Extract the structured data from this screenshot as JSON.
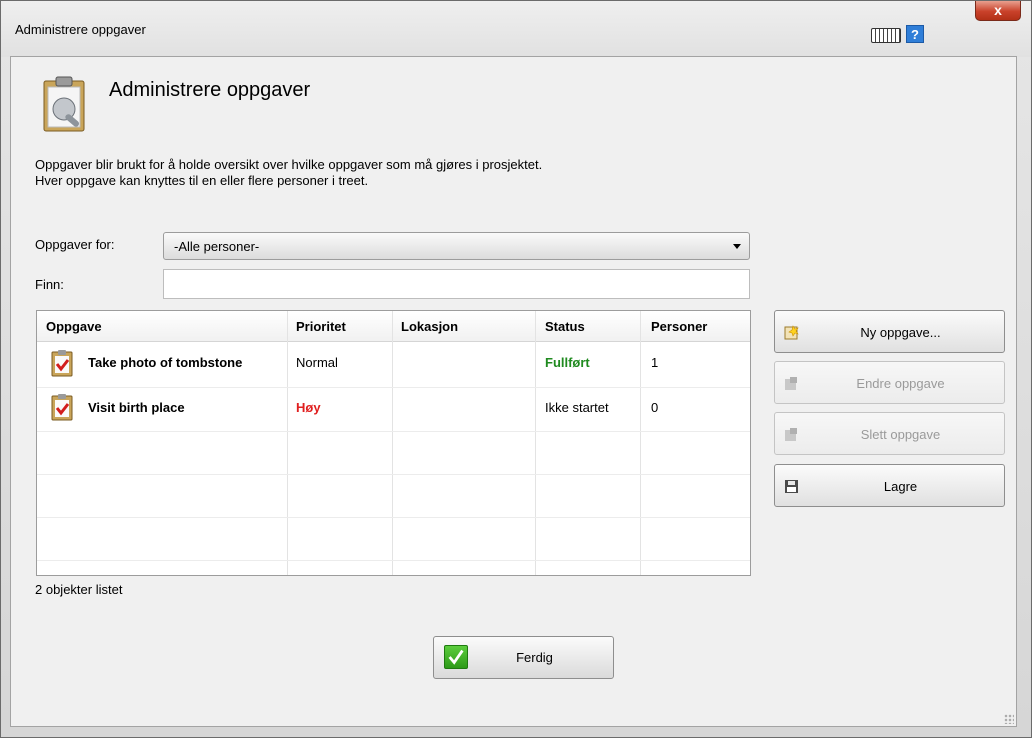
{
  "window": {
    "title": "Administrere oppgaver",
    "close_label": "x",
    "help_label": "?"
  },
  "header": {
    "title": "Administrere oppgaver",
    "description_line1": "Oppgaver blir brukt for å holde oversikt over hvilke oppgaver som må gjøres i prosjektet.",
    "description_line2": "Hver oppgave kan knyttes til en eller flere personer i treet."
  },
  "filter": {
    "label": "Oppgaver for:",
    "selected": "-Alle personer-"
  },
  "search": {
    "label": "Finn:",
    "value": "",
    "placeholder": ""
  },
  "table": {
    "columns": [
      "Oppgave",
      "Prioritet",
      "Lokasjon",
      "Status",
      "Personer"
    ],
    "rows": [
      {
        "task": "Take photo of tombstone",
        "priority": "Normal",
        "location": "",
        "status": "Fullført",
        "persons": "1"
      },
      {
        "task": "Visit birth place",
        "priority": "Høy",
        "location": "",
        "status": "Ikke startet",
        "persons": "0"
      }
    ],
    "count_text": "2 objekter listet"
  },
  "buttons": {
    "new_task": "Ny oppgave...",
    "edit_task": "Endre oppgave",
    "delete_task": "Slett oppgave",
    "save": "Lagre",
    "done": "Ferdig"
  },
  "colors": {
    "status_done": "#1f8a1f",
    "priority_high": "#e01f1f"
  }
}
